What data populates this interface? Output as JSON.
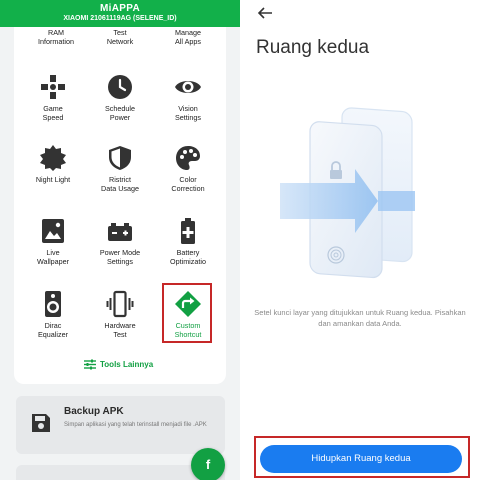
{
  "left": {
    "app_title": "MiAPPA",
    "device": "XIAOMI 21061119AG (SELENE_ID)",
    "top_row": [
      {
        "l1": "RAM",
        "l2": "Information"
      },
      {
        "l1": "Test",
        "l2": "Network"
      },
      {
        "l1": "Manage",
        "l2": "All Apps"
      }
    ],
    "tiles": [
      {
        "l1": "Game",
        "l2": "Speed",
        "icon": "gamepad-icon"
      },
      {
        "l1": "Schedule",
        "l2": "Power",
        "icon": "clock-icon"
      },
      {
        "l1": "Vision",
        "l2": "Settings",
        "icon": "eye-icon"
      },
      {
        "l1": "Night Light",
        "l2": "",
        "icon": "night-light-icon"
      },
      {
        "l1": "Ristrict",
        "l2": "Data Usage",
        "icon": "shield-icon"
      },
      {
        "l1": "Color",
        "l2": "Correction",
        "icon": "palette-icon"
      },
      {
        "l1": "Live",
        "l2": "Wallpaper",
        "icon": "image-icon"
      },
      {
        "l1": "Power Mode",
        "l2": "Settings",
        "icon": "battery-car-icon"
      },
      {
        "l1": "Battery",
        "l2": "Optimizatio",
        "icon": "battery-plus-icon"
      },
      {
        "l1": "Dirac",
        "l2": "Equalizer",
        "icon": "speaker-icon"
      },
      {
        "l1": "Hardware",
        "l2": "Test",
        "icon": "vibrate-icon"
      },
      {
        "l1": "Custom",
        "l2": "Shortcut",
        "icon": "shortcut-icon"
      }
    ],
    "tools_label": "Tools Lainnya",
    "backup_title": "Backup APK",
    "backup_desc": "Simpan aplikasi yang telah terinstall menjadi file .APK",
    "fab_label": "f"
  },
  "right": {
    "title": "Ruang kedua",
    "description": "Setel kunci layar yang ditujukkan untuk Ruang kedua. Pisahkan dan amankan data Anda.",
    "button_label": "Hidupkan Ruang kedua"
  },
  "colors": {
    "brand_green": "#12b04a",
    "accent_blue": "#1a7cf0",
    "highlight_red": "#c62828"
  }
}
